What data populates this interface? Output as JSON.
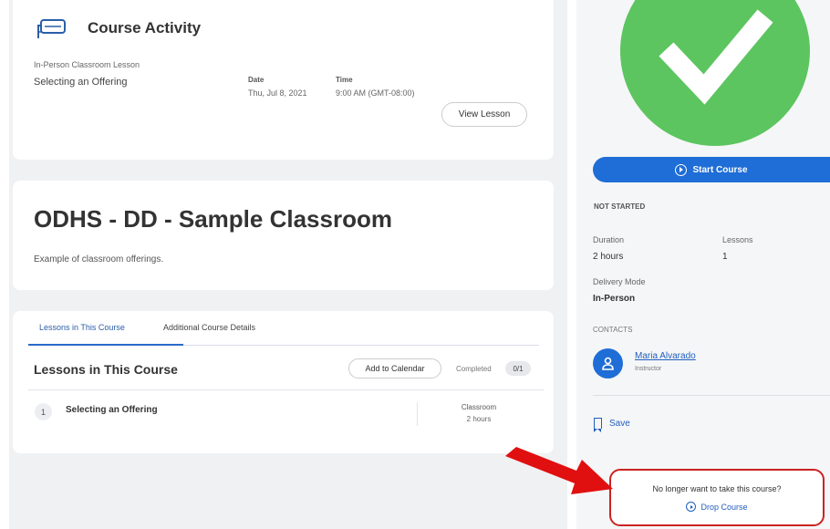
{
  "activity": {
    "title": "Course Activity",
    "lesson_type": "In-Person Classroom Lesson",
    "lesson_name": "Selecting an Offering",
    "date_label": "Date",
    "date_value": "Thu, Jul 8, 2021",
    "time_label": "Time",
    "time_value": "9:00 AM (GMT-08:00)",
    "view_lesson_label": "View Lesson"
  },
  "course": {
    "title": "ODHS - DD - Sample Classroom",
    "description": "Example of classroom offerings."
  },
  "tabs": [
    {
      "label": "Lessons in This Course",
      "active": true
    },
    {
      "label": "Additional Course Details",
      "active": false
    }
  ],
  "lessons": {
    "heading": "Lessons in This Course",
    "add_calendar_label": "Add to Calendar",
    "completed_label": "Completed",
    "completed_count": "0/1",
    "rows": [
      {
        "number": "1",
        "name": "Selecting an Offering",
        "type": "Classroom",
        "duration": "2 hours"
      }
    ]
  },
  "sidebar": {
    "start_label": "Start Course",
    "status": "NOT STARTED",
    "duration_label": "Duration",
    "duration_value": "2 hours",
    "lessons_label": "Lessons",
    "lessons_value": "1",
    "delivery_label": "Delivery Mode",
    "delivery_value": "In-Person",
    "contacts_label": "CONTACTS",
    "contact_name": "Maria Alvarado",
    "contact_role": "Instructor",
    "save_label": "Save",
    "drop_question": "No longer want to take this course?",
    "drop_label": "Drop Course"
  },
  "colors": {
    "accent": "#1f6dd6",
    "success": "#5cc560",
    "highlight": "#cc2222"
  }
}
